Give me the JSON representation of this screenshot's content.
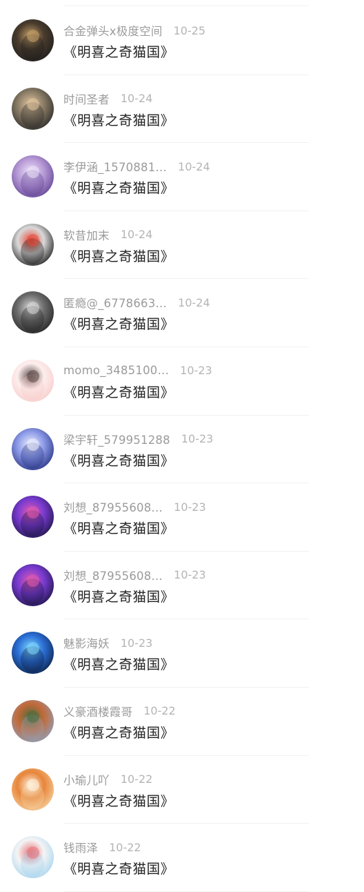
{
  "comments": [
    {
      "name": "合金弹头x极度空间",
      "time": "10-25",
      "message": "《明喜之奇猫国》",
      "avatar_icon": "photo-avatar-icon",
      "colors": [
        "#1a1a1a",
        "#4a3c2e",
        "#c8a36a"
      ]
    },
    {
      "name": "时间圣者",
      "time": "10-24",
      "message": "《明喜之奇猫国》",
      "avatar_icon": "photo-avatar-icon",
      "colors": [
        "#222222",
        "#8a7c66",
        "#e3c7a0"
      ]
    },
    {
      "name": "李伊涵_1570881…",
      "time": "10-24",
      "message": "《明喜之奇猫国》",
      "avatar_icon": "photo-avatar-icon",
      "colors": [
        "#5a3c8e",
        "#b79ad6",
        "#efe4fa"
      ]
    },
    {
      "name": "软昔加末",
      "time": "10-24",
      "message": "《明喜之奇猫国》",
      "avatar_icon": "photo-avatar-icon",
      "colors": [
        "#0d0d0d",
        "#d9d9d9",
        "#e84b3c"
      ]
    },
    {
      "name": "匿瘾@_6778663…",
      "time": "10-24",
      "message": "《明喜之奇猫国》",
      "avatar_icon": "photo-avatar-icon",
      "colors": [
        "#1c1c1c",
        "#6e6e6e",
        "#dcdcdc"
      ]
    },
    {
      "name": "momo_3485100…",
      "time": "10-23",
      "message": "《明喜之奇猫国》",
      "avatar_icon": "photo-avatar-icon",
      "colors": [
        "#f7c9c6",
        "#fdeeee",
        "#5b4a48"
      ]
    },
    {
      "name": "梁宇轩_579951288",
      "time": "10-23",
      "message": "《明喜之奇猫国》",
      "avatar_icon": "photo-avatar-icon",
      "colors": [
        "#1e2a7a",
        "#8d9be8",
        "#f0f3ff"
      ]
    },
    {
      "name": "刘想_87955608…",
      "time": "10-23",
      "message": "《明喜之奇猫国》",
      "avatar_icon": "photo-avatar-icon",
      "colors": [
        "#14123a",
        "#7a3bd1",
        "#e35bb0"
      ]
    },
    {
      "name": "刘想_87955608…",
      "time": "10-23",
      "message": "《明喜之奇猫国》",
      "avatar_icon": "photo-avatar-icon",
      "colors": [
        "#14123a",
        "#7a3bd1",
        "#e35bb0"
      ]
    },
    {
      "name": "魅影海妖",
      "time": "10-23",
      "message": "《明喜之奇猫国》",
      "avatar_icon": "photo-avatar-icon",
      "colors": [
        "#0a1a3a",
        "#2b6fd6",
        "#7fd8ff"
      ]
    },
    {
      "name": "义豪酒楼霞哥",
      "time": "10-22",
      "message": "《明喜之奇猫国》",
      "avatar_icon": "photo-avatar-icon",
      "colors": [
        "#8aa6c7",
        "#c26a3a",
        "#4f6b3a"
      ]
    },
    {
      "name": "小瑜儿吖",
      "time": "10-22",
      "message": "《明喜之奇猫国》",
      "avatar_icon": "photo-avatar-icon",
      "colors": [
        "#f7d8a8",
        "#e7853a",
        "#fff4e2"
      ]
    },
    {
      "name": "钱雨泽",
      "time": "10-22",
      "message": "《明喜之奇猫国》",
      "avatar_icon": "photo-avatar-icon",
      "colors": [
        "#9fd1ee",
        "#f4f4f4",
        "#e8737a"
      ]
    }
  ]
}
